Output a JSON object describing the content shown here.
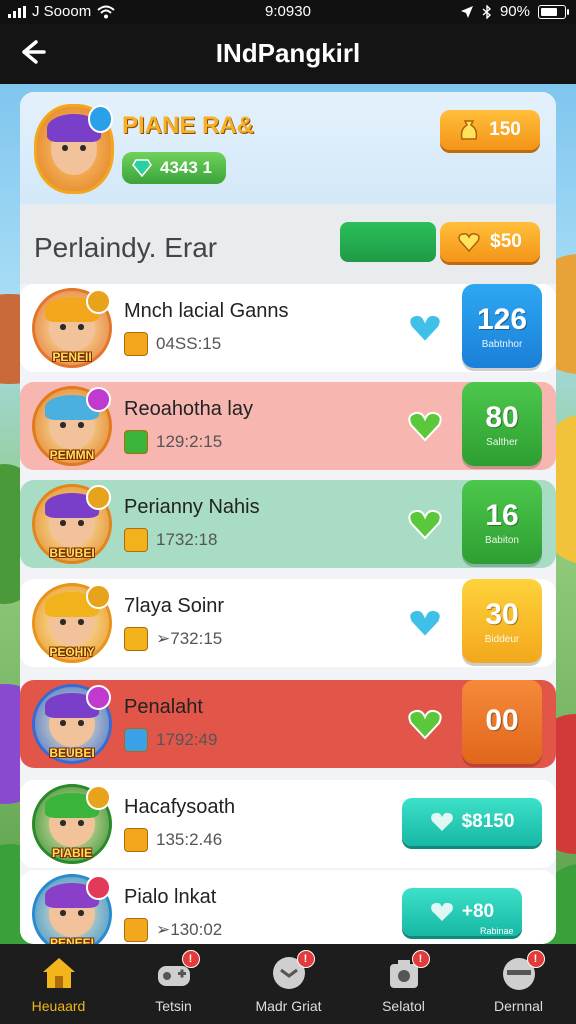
{
  "status": {
    "carrier": "J Sooom",
    "time": "9:0930",
    "battery": "90%"
  },
  "header": {
    "title": "INdPangkirl"
  },
  "profile": {
    "name": "PIANE RA&",
    "avatar_banner": "",
    "gems": "4343 1",
    "coins": "150"
  },
  "section": {
    "title": "Perlaindy. Erar",
    "coins": "$50"
  },
  "rows": [
    {
      "name": "Mnch lacial Ganns",
      "sub": "04SS:15",
      "avatar_banner": "PENEII",
      "score": "126",
      "score_label": "Babtnhor",
      "hair": "#f2a71c",
      "ring": "#e2762a",
      "badge": "#e8a31c"
    },
    {
      "name": "Reoahotha lay",
      "sub": "129:2:15",
      "avatar_banner": "PEMMN",
      "score": "80",
      "score_label": "Salther",
      "hair": "#4ab0e0",
      "ring": "#e07a1c",
      "badge": "#c03ad0"
    },
    {
      "name": "Perianny Nahis",
      "sub": "1732:18",
      "avatar_banner": "BEUBEI",
      "score": "16",
      "score_label": "Babiton",
      "hair": "#7a3fc8",
      "ring": "#e0861c",
      "badge": "#e8a31c"
    },
    {
      "name": "7laya Soinr",
      "sub": "➢732:15",
      "avatar_banner": "PEOHIY",
      "score": "30",
      "score_label": "Biddeur",
      "hair": "#f2b21c",
      "ring": "#e8941c",
      "badge": "#e8a31c"
    },
    {
      "name": "Penalaht",
      "sub": "1792:49",
      "avatar_banner": "BEUBEI",
      "score": "00",
      "score_label": "",
      "hair": "#7a3fc8",
      "ring": "#3a6ad0",
      "badge": "#c03ad0"
    },
    {
      "name": "Hacafysoath",
      "sub": "135:2.46",
      "avatar_banner": "PIABIE",
      "pill": "$8150",
      "hair": "#3ab43a",
      "ring": "#2a8a2a",
      "badge": "#e8a31c"
    },
    {
      "name": "Pialo lnkat",
      "sub": "➢130:02",
      "avatar_banner": "PENEEI",
      "pill": "+80",
      "pill_label": "Rabinae",
      "hair": "#8a3fc8",
      "ring": "#2a8ad0",
      "badge": "#e23b5a"
    }
  ],
  "nav": [
    {
      "label": "Heuaard",
      "active": true
    },
    {
      "label": "Tetsin"
    },
    {
      "label": "Madr Griat"
    },
    {
      "label": "Selatol"
    },
    {
      "label": "Dernnal"
    }
  ],
  "colors": {
    "accent": "#f49418",
    "green": "#3aa33a",
    "blue": "#1e8ee0",
    "teal": "#16b8a4"
  }
}
